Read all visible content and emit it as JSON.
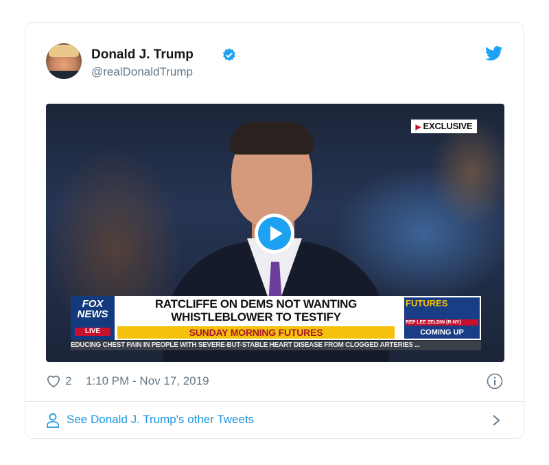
{
  "tweet": {
    "author_name": "Donald J. Trump",
    "author_handle": "@realDonaldTrump",
    "likes": "2",
    "timestamp": "1:10 PM - Nov 17, 2019",
    "footer_link": "See Donald J. Trump's other Tweets"
  },
  "video": {
    "badge": "EXCLUSIVE",
    "network_logo": "FOX NEWS",
    "network_live": "LIVE",
    "headline_line1": "RATCLIFFE ON DEMS NOT WANTING",
    "headline_line2": "WHISTLEBLOWER TO TESTIFY",
    "show_name": "SUNDAY MORNING FUTURES",
    "promo_title": "FUTURES",
    "promo_guest": "REP LEE ZELDIN (R-NY)",
    "promo_coming": "COMING UP",
    "ticker": "EDUCING CHEST PAIN IN PEOPLE WITH SEVERE-BUT-STABLE HEART DISEASE FROM CLOGGED ARTERIES ..."
  },
  "colors": {
    "brand_blue": "#1da1f2",
    "link_blue": "#1b95e0",
    "muted_gray": "#657786",
    "border": "#e1e8ed"
  },
  "icons": {
    "verified": "verified-badge-icon",
    "logo": "twitter-bird-icon",
    "play": "play-icon",
    "like": "heart-icon",
    "info": "info-icon",
    "profile": "person-icon",
    "chevron": "chevron-right-icon"
  }
}
